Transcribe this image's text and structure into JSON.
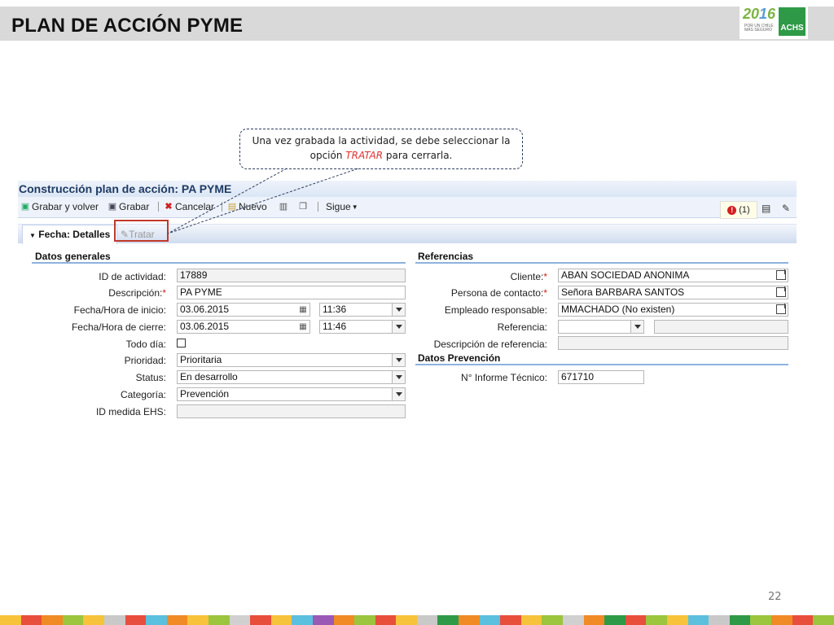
{
  "slide": {
    "title": "PLAN DE ACCIÓN PYME",
    "page_number": "22",
    "logo": {
      "year_a": "20",
      "year_b": "1",
      "year_c": "6",
      "sub": "POR UN CHILE MÁS SEGURO",
      "brand": "ACHS"
    }
  },
  "callout": {
    "line1": "Una vez grabada la actividad, se debe seleccionar la",
    "line2_pre": "opción ",
    "line2_kw": "TRATAR",
    "line2_post": " para cerrarla."
  },
  "sap": {
    "title": "Construcción plan de acción: PA PYME",
    "toolbar": {
      "save_and_back": "Grabar y volver",
      "save": "Grabar",
      "cancel": "Cancelar",
      "new": "Nuevo",
      "more": "Sigue"
    },
    "alert_count": "(1)",
    "tabs": {
      "active": "Fecha: Detalles",
      "tratar": "Tratar"
    },
    "general": {
      "section": "Datos generales",
      "activity_id_label": "ID de actividad:",
      "activity_id": "17889",
      "description_label": "Descripción:",
      "description": "PA PYME",
      "start_label": "Fecha/Hora de inicio:",
      "start_date": "03.06.2015",
      "start_time": "11:36",
      "end_label": "Fecha/Hora de cierre:",
      "end_date": "03.06.2015",
      "end_time": "11:46",
      "allday_label": "Todo día:",
      "priority_label": "Prioridad:",
      "priority": "Prioritaria",
      "status_label": "Status:",
      "status": "En desarrollo",
      "category_label": "Categoría:",
      "category": "Prevención",
      "ehs_label": "ID medida EHS:"
    },
    "references": {
      "section": "Referencias",
      "client_label": "Cliente:",
      "client": "ABAN SOCIEDAD ANONIMA",
      "contact_label": "Persona de contacto:",
      "contact": "Señora BARBARA SANTOS",
      "employee_label": "Empleado responsable:",
      "employee": "MMACHADO (No existen)",
      "reference_label": "Referencia:",
      "ref_desc_label": "Descripción de referencia:"
    },
    "prevention": {
      "section": "Datos Prevención",
      "report_label": "N° Informe Técnico:",
      "report": "671710"
    }
  },
  "colors": {
    "highlight_box": "#c0392b",
    "keyword": "#e03030",
    "section_line": "#8fb2de"
  }
}
